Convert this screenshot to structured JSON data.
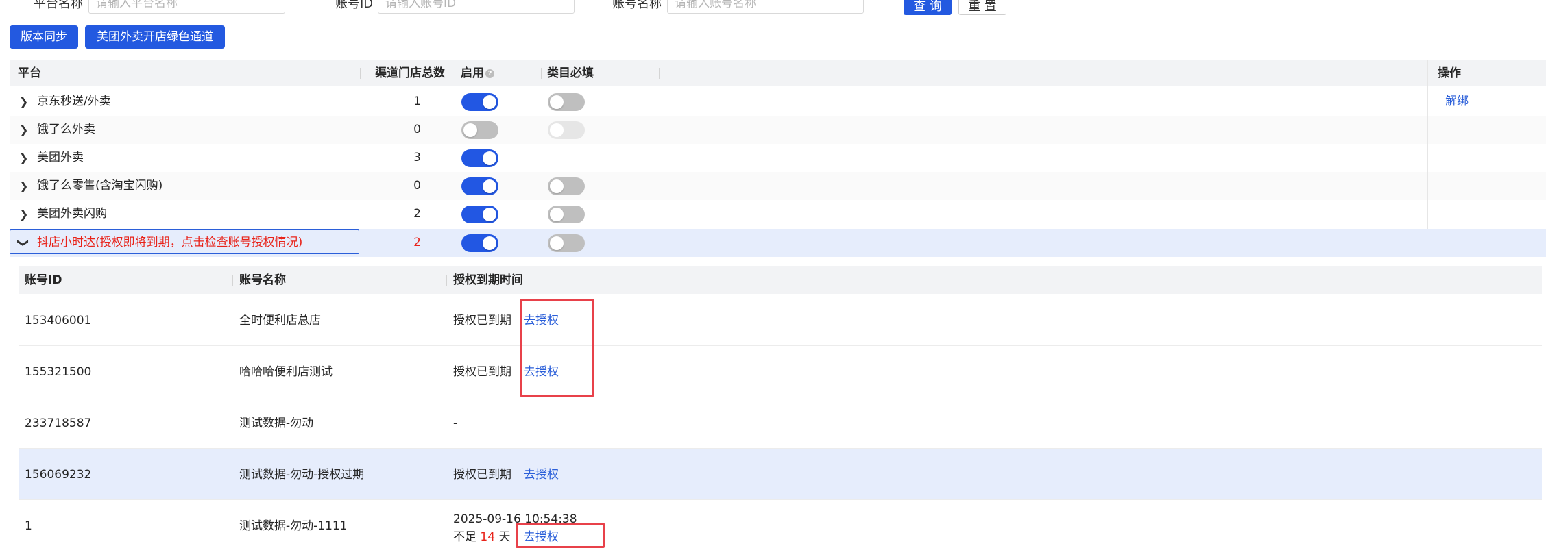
{
  "search": {
    "platform_label": "平台名称",
    "platform_placeholder": "请输入平台名称",
    "account_id_label": "账号ID",
    "account_id_placeholder": "请输入账号ID",
    "account_name_label": "账号名称",
    "account_name_placeholder": "请输入账号名称",
    "query_label": "查 询",
    "reset_label": "重 置"
  },
  "actions": {
    "sync_label": "版本同步",
    "green_channel_label": "美团外卖开店绿色通道"
  },
  "main_table": {
    "columns": [
      "平台",
      "渠道门店总数",
      "启用",
      "类目必填",
      "操作"
    ],
    "rows": [
      {
        "name": "京东秒送/外卖",
        "count": "1",
        "enabled": true,
        "category": "off",
        "action": "解绑"
      },
      {
        "name": "饿了么外卖",
        "count": "0",
        "enabled": false,
        "category": "disabled",
        "action": ""
      },
      {
        "name": "美团外卖",
        "count": "3",
        "enabled": true,
        "category": "none",
        "action": ""
      },
      {
        "name": "饿了么零售(含淘宝闪购)",
        "count": "0",
        "enabled": true,
        "category": "off",
        "action": ""
      },
      {
        "name": "美团外卖闪购",
        "count": "2",
        "enabled": true,
        "category": "off",
        "action": ""
      },
      {
        "name": "抖店小时达(授权即将到期，点击检查账号授权情况)",
        "count": "2",
        "enabled": true,
        "category": "off",
        "action": ""
      }
    ]
  },
  "sub_table": {
    "columns": [
      "账号ID",
      "账号名称",
      "授权到期时间"
    ],
    "rows": [
      {
        "id": "153406001",
        "name": "全时便利店总店",
        "status": "授权已到期",
        "link": "去授权"
      },
      {
        "id": "155321500",
        "name": "哈哈哈便利店测试",
        "status": "授权已到期",
        "link": "去授权"
      },
      {
        "id": "233718587",
        "name": "测试数据-勿动",
        "status": "-",
        "link": ""
      },
      {
        "id": "156069232",
        "name": "测试数据-勿动-授权过期",
        "status": "授权已到期",
        "link": "去授权"
      },
      {
        "id": "1",
        "name": "测试数据-勿动-1111",
        "expire_time": "2025-09-16 10:54:38",
        "remain_prefix": "不足",
        "remain_days": "14",
        "remain_suffix": "天",
        "link": "去授权"
      }
    ]
  },
  "colors": {
    "primary": "#2359e0",
    "link": "#2b5fd9",
    "warning_red": "#e8231a",
    "highlight_box": "#e8414a",
    "selected_row": "#e6edfc"
  }
}
